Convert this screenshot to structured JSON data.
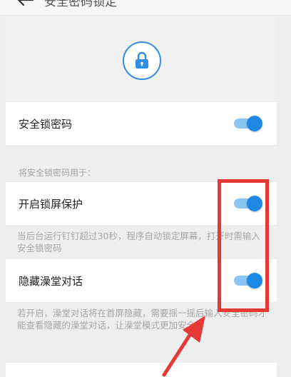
{
  "header": {
    "title": "安全密码锁定",
    "back_icon": "arrow-left-icon"
  },
  "hero": {
    "lock_icon": "lock-icon",
    "accent_color": "#1e88e5"
  },
  "settings": {
    "main_toggle": {
      "label": "安全锁密码",
      "enabled": true
    },
    "section_caption": "将安全锁密码用于：",
    "lock_screen": {
      "label": "开启锁屏保护",
      "enabled": true,
      "description": "当后台运行钉钉超过30秒，程序自动锁定屏幕，打开时需输入安全锁密码"
    },
    "hide_chat": {
      "label": "隐藏澡堂对话",
      "enabled": true,
      "description": "若开启，澡堂对话将在首屏隐藏，需要摇一摇后输入安全密码才能查看隐藏的澡堂对话，让澡堂模式更加安全"
    }
  },
  "annotation": {
    "highlight_color": "#e53935"
  }
}
